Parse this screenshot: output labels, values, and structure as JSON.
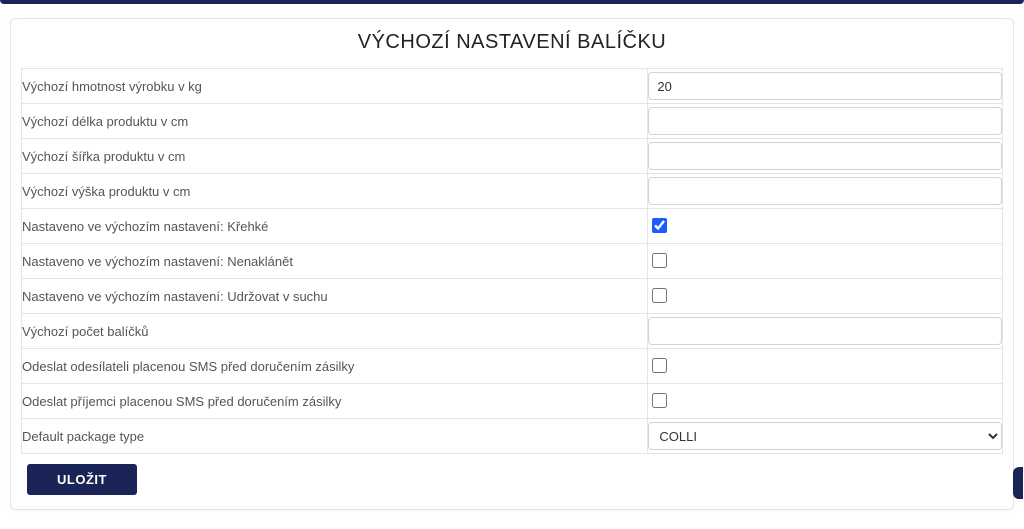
{
  "header": {
    "title": "VÝCHOZÍ NASTAVENÍ BALÍČKU"
  },
  "fields": {
    "weight": {
      "label": "Výchozí hmotnost výrobku v kg",
      "value": "20"
    },
    "length": {
      "label": "Výchozí délka produktu v cm",
      "value": ""
    },
    "width": {
      "label": "Výchozí šířka produktu v cm",
      "value": ""
    },
    "height": {
      "label": "Výchozí výška produktu v cm",
      "value": ""
    },
    "fragile": {
      "label": "Nastaveno ve výchozím nastavení: Křehké",
      "checked": true
    },
    "notilt": {
      "label": "Nastaveno ve výchozím nastavení: Nenaklánět",
      "checked": false
    },
    "keepdry": {
      "label": "Nastaveno ve výchozím nastavení: Udržovat v suchu",
      "checked": false
    },
    "count": {
      "label": "Výchozí počet balíčků",
      "value": ""
    },
    "smssender": {
      "label": "Odeslat odesílateli placenou SMS před doručením zásilky",
      "checked": false
    },
    "smsrecip": {
      "label": "Odeslat příjemci placenou SMS před doručením zásilky",
      "checked": false
    },
    "pkgtype": {
      "label": "Default package type",
      "value": "COLLI",
      "options": [
        "COLLI"
      ]
    }
  },
  "actions": {
    "save_label": "ULOŽIT"
  }
}
